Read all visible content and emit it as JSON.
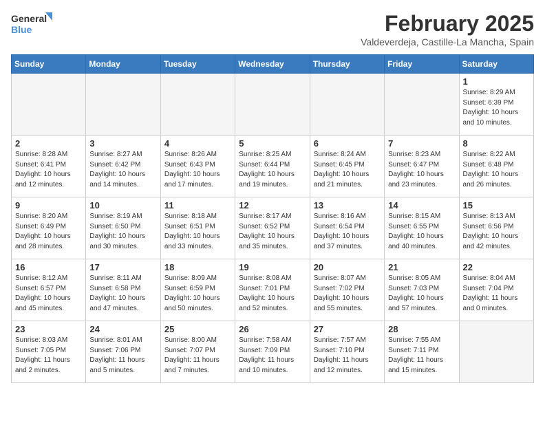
{
  "header": {
    "logo_line1": "General",
    "logo_line2": "Blue",
    "title": "February 2025",
    "subtitle": "Valdeverdeja, Castille-La Mancha, Spain"
  },
  "days_of_week": [
    "Sunday",
    "Monday",
    "Tuesday",
    "Wednesday",
    "Thursday",
    "Friday",
    "Saturday"
  ],
  "weeks": [
    [
      {
        "day": "",
        "info": ""
      },
      {
        "day": "",
        "info": ""
      },
      {
        "day": "",
        "info": ""
      },
      {
        "day": "",
        "info": ""
      },
      {
        "day": "",
        "info": ""
      },
      {
        "day": "",
        "info": ""
      },
      {
        "day": "1",
        "info": "Sunrise: 8:29 AM\nSunset: 6:39 PM\nDaylight: 10 hours\nand 10 minutes."
      }
    ],
    [
      {
        "day": "2",
        "info": "Sunrise: 8:28 AM\nSunset: 6:41 PM\nDaylight: 10 hours\nand 12 minutes."
      },
      {
        "day": "3",
        "info": "Sunrise: 8:27 AM\nSunset: 6:42 PM\nDaylight: 10 hours\nand 14 minutes."
      },
      {
        "day": "4",
        "info": "Sunrise: 8:26 AM\nSunset: 6:43 PM\nDaylight: 10 hours\nand 17 minutes."
      },
      {
        "day": "5",
        "info": "Sunrise: 8:25 AM\nSunset: 6:44 PM\nDaylight: 10 hours\nand 19 minutes."
      },
      {
        "day": "6",
        "info": "Sunrise: 8:24 AM\nSunset: 6:45 PM\nDaylight: 10 hours\nand 21 minutes."
      },
      {
        "day": "7",
        "info": "Sunrise: 8:23 AM\nSunset: 6:47 PM\nDaylight: 10 hours\nand 23 minutes."
      },
      {
        "day": "8",
        "info": "Sunrise: 8:22 AM\nSunset: 6:48 PM\nDaylight: 10 hours\nand 26 minutes."
      }
    ],
    [
      {
        "day": "9",
        "info": "Sunrise: 8:20 AM\nSunset: 6:49 PM\nDaylight: 10 hours\nand 28 minutes."
      },
      {
        "day": "10",
        "info": "Sunrise: 8:19 AM\nSunset: 6:50 PM\nDaylight: 10 hours\nand 30 minutes."
      },
      {
        "day": "11",
        "info": "Sunrise: 8:18 AM\nSunset: 6:51 PM\nDaylight: 10 hours\nand 33 minutes."
      },
      {
        "day": "12",
        "info": "Sunrise: 8:17 AM\nSunset: 6:52 PM\nDaylight: 10 hours\nand 35 minutes."
      },
      {
        "day": "13",
        "info": "Sunrise: 8:16 AM\nSunset: 6:54 PM\nDaylight: 10 hours\nand 37 minutes."
      },
      {
        "day": "14",
        "info": "Sunrise: 8:15 AM\nSunset: 6:55 PM\nDaylight: 10 hours\nand 40 minutes."
      },
      {
        "day": "15",
        "info": "Sunrise: 8:13 AM\nSunset: 6:56 PM\nDaylight: 10 hours\nand 42 minutes."
      }
    ],
    [
      {
        "day": "16",
        "info": "Sunrise: 8:12 AM\nSunset: 6:57 PM\nDaylight: 10 hours\nand 45 minutes."
      },
      {
        "day": "17",
        "info": "Sunrise: 8:11 AM\nSunset: 6:58 PM\nDaylight: 10 hours\nand 47 minutes."
      },
      {
        "day": "18",
        "info": "Sunrise: 8:09 AM\nSunset: 6:59 PM\nDaylight: 10 hours\nand 50 minutes."
      },
      {
        "day": "19",
        "info": "Sunrise: 8:08 AM\nSunset: 7:01 PM\nDaylight: 10 hours\nand 52 minutes."
      },
      {
        "day": "20",
        "info": "Sunrise: 8:07 AM\nSunset: 7:02 PM\nDaylight: 10 hours\nand 55 minutes."
      },
      {
        "day": "21",
        "info": "Sunrise: 8:05 AM\nSunset: 7:03 PM\nDaylight: 10 hours\nand 57 minutes."
      },
      {
        "day": "22",
        "info": "Sunrise: 8:04 AM\nSunset: 7:04 PM\nDaylight: 11 hours\nand 0 minutes."
      }
    ],
    [
      {
        "day": "23",
        "info": "Sunrise: 8:03 AM\nSunset: 7:05 PM\nDaylight: 11 hours\nand 2 minutes."
      },
      {
        "day": "24",
        "info": "Sunrise: 8:01 AM\nSunset: 7:06 PM\nDaylight: 11 hours\nand 5 minutes."
      },
      {
        "day": "25",
        "info": "Sunrise: 8:00 AM\nSunset: 7:07 PM\nDaylight: 11 hours\nand 7 minutes."
      },
      {
        "day": "26",
        "info": "Sunrise: 7:58 AM\nSunset: 7:09 PM\nDaylight: 11 hours\nand 10 minutes."
      },
      {
        "day": "27",
        "info": "Sunrise: 7:57 AM\nSunset: 7:10 PM\nDaylight: 11 hours\nand 12 minutes."
      },
      {
        "day": "28",
        "info": "Sunrise: 7:55 AM\nSunset: 7:11 PM\nDaylight: 11 hours\nand 15 minutes."
      },
      {
        "day": "",
        "info": ""
      }
    ]
  ]
}
